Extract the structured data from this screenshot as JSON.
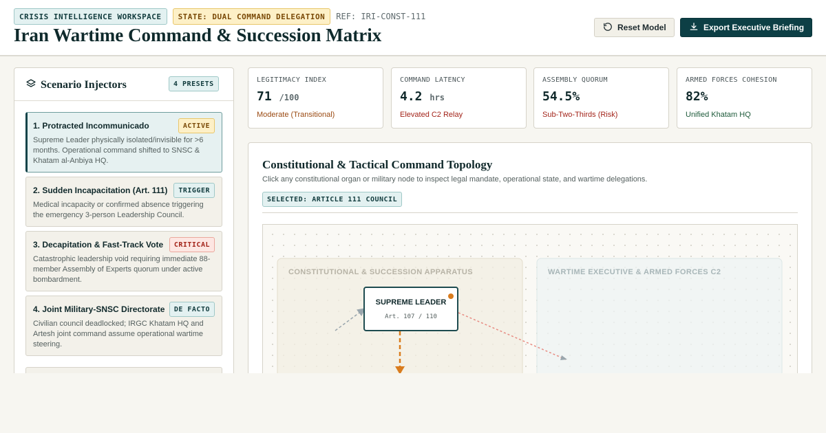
{
  "header": {
    "badge_workspace": "CRISIS INTELLIGENCE WORKSPACE",
    "badge_state": "STATE: DUAL COMMAND DELEGATION",
    "ref": "REF: IRI-CONST-111",
    "title": "Iran Wartime Command & Succession Matrix",
    "reset_label": "Reset Model",
    "export_label": "Export Executive Briefing",
    "icons": {
      "reset": "rotate-ccw-icon",
      "export": "download-icon"
    }
  },
  "sidebar": {
    "title": "Scenario Injectors",
    "icon": "layers-icon",
    "presets_badge": "4 PRESETS",
    "scenarios": [
      {
        "title": "1. Protracted Incommunicado",
        "tag": "ACTIVE",
        "desc": "Supreme Leader physically isolated/invisible for >6 months. Operational command shifted to SNSC & Khatam al-Anbiya HQ."
      },
      {
        "title": "2. Sudden Incapacitation (Art. 111)",
        "tag": "TRIGGER",
        "desc": "Medical incapacity or confirmed absence triggering the emergency 3-person Leadership Council."
      },
      {
        "title": "3. Decapitation & Fast-Track Vote",
        "tag": "CRITICAL",
        "desc": "Catastrophic leadership void requiring immediate 88-member Assembly of Experts quorum under active bombardment."
      },
      {
        "title": "4. Joint Military-SNSC Directorate",
        "tag": "DE FACTO",
        "desc": "Civilian council deadlocked; IRGC Khatam HQ and Artesh joint command assume operational wartime steering."
      }
    ]
  },
  "metrics": [
    {
      "label": "LEGITIMACY INDEX",
      "value": "71",
      "unit": "/100",
      "note": "Moderate (Transitional)",
      "note_color": "#9a4a12"
    },
    {
      "label": "COMMAND LATENCY",
      "value": "4.2",
      "unit": "hrs",
      "note": "Elevated C2 Relay",
      "note_color": "#a3241a"
    },
    {
      "label": "ASSEMBLY QUORUM",
      "value": "54.5%",
      "unit": "",
      "note": "Sub-Two-Thirds (Risk)",
      "note_color": "#a3241a"
    },
    {
      "label": "ARMED FORCES COHESION",
      "value": "82%",
      "unit": "",
      "note": "Unified Khatam HQ",
      "note_color": "#1d5a3a"
    }
  ],
  "topology": {
    "title": "Constitutional & Tactical Command Topology",
    "subtitle": "Click any constitutional organ or military node to inspect legal mandate, operational state, and wartime delegations.",
    "selected": "SELECTED: ARTICLE 111 COUNCIL",
    "zone_left": "CONSTITUTIONAL & SUCCESSION APPARATUS",
    "zone_right": "WARTIME EXECUTIVE & ARMED FORCES C2",
    "node_leader": {
      "label": "SUPREME LEADER",
      "sub": "Art. 107 / 110"
    }
  }
}
